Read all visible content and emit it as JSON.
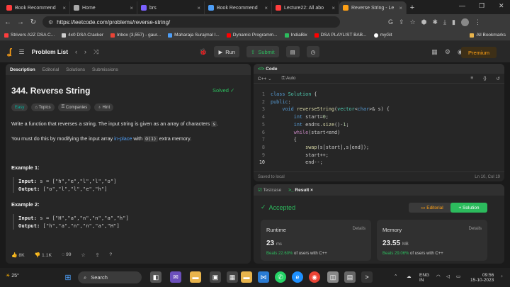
{
  "browser": {
    "tabs": [
      {
        "label": "Book Recommend",
        "color": "#ff3d3d"
      },
      {
        "label": "Home",
        "color": "#aaaaaa"
      },
      {
        "label": "brs",
        "color": "#7b61ff"
      },
      {
        "label": "Book Recommend",
        "color": "#4d9ef7"
      },
      {
        "label": "Lecture22: All abo",
        "color": "#ff3d3d"
      },
      {
        "label": "Reverse String - Le",
        "color": "#ffa116"
      }
    ],
    "url": "https://leetcode.com/problems/reverse-string/",
    "bookmarks": [
      "Strivers A2Z DSA C...",
      "4x0 DSA Cracker",
      "Inbox (3,557) - gaur...",
      "Maharaja Surajmal I...",
      "Dynamic Programm...",
      "IndiaBix",
      "DSA PLAYLIST BAB...",
      "myGit"
    ],
    "all_bookmarks": "All Bookmarks"
  },
  "header": {
    "problem_list": "Problem List",
    "run": "Run",
    "submit": "Submit",
    "coins": "0",
    "premium": "Premium"
  },
  "left": {
    "tabs": [
      "Description",
      "Editorial",
      "Solutions",
      "Submissions"
    ],
    "title": "344. Reverse String",
    "solved": "Solved",
    "chips": [
      "Easy",
      "Topics",
      "Companies",
      "Hint"
    ],
    "desc1": "Write a function that reverses a string. The input string is given as an array of characters",
    "desc1_code": "s",
    "desc2_pre": "You must do this by modifying the input array",
    "desc2_link": "in-place",
    "desc2_mid": "with",
    "desc2_code": "O(1)",
    "desc2_post": "extra memory.",
    "ex1_title": "Example 1:",
    "ex1_input_label": "Input:",
    "ex1_input": "s = [\"h\",\"e\",\"l\",\"l\",\"o\"]",
    "ex1_output_label": "Output:",
    "ex1_output": "[\"o\",\"l\",\"l\",\"e\",\"h\"]",
    "ex2_title": "Example 2:",
    "ex2_input_label": "Input:",
    "ex2_input": "s = [\"H\",\"a\",\"n\",\"n\",\"a\",\"h\"]",
    "ex2_output_label": "Output:",
    "ex2_output": "[\"h\",\"a\",\"n\",\"n\",\"a\",\"H\"]",
    "likes": "8K",
    "dislikes": "1.1K",
    "comments": "99"
  },
  "code": {
    "title": "Code",
    "lang": "C++",
    "mode": "Auto",
    "saved": "Saved to local",
    "cursor": "Ln 10, Col 19"
  },
  "result": {
    "tab_testcase": "Testcase",
    "tab_result": "Result",
    "status": "Accepted",
    "editorial": "Editorial",
    "solution": "+ Solution",
    "runtime_label": "Runtime",
    "runtime_value": "23",
    "runtime_unit": "ms",
    "runtime_beats": "Beats 22.60%",
    "runtime_suffix": "of users with C++",
    "memory_label": "Memory",
    "memory_value": "23.55",
    "memory_unit": "MB",
    "memory_beats": "Beats 29.06%",
    "memory_suffix": "of users with C++",
    "details": "Details"
  },
  "taskbar": {
    "temp": "25°",
    "search": "Search",
    "lang1": "ENG",
    "lang2": "IN",
    "time": "09:56",
    "date": "15-10-2023"
  }
}
